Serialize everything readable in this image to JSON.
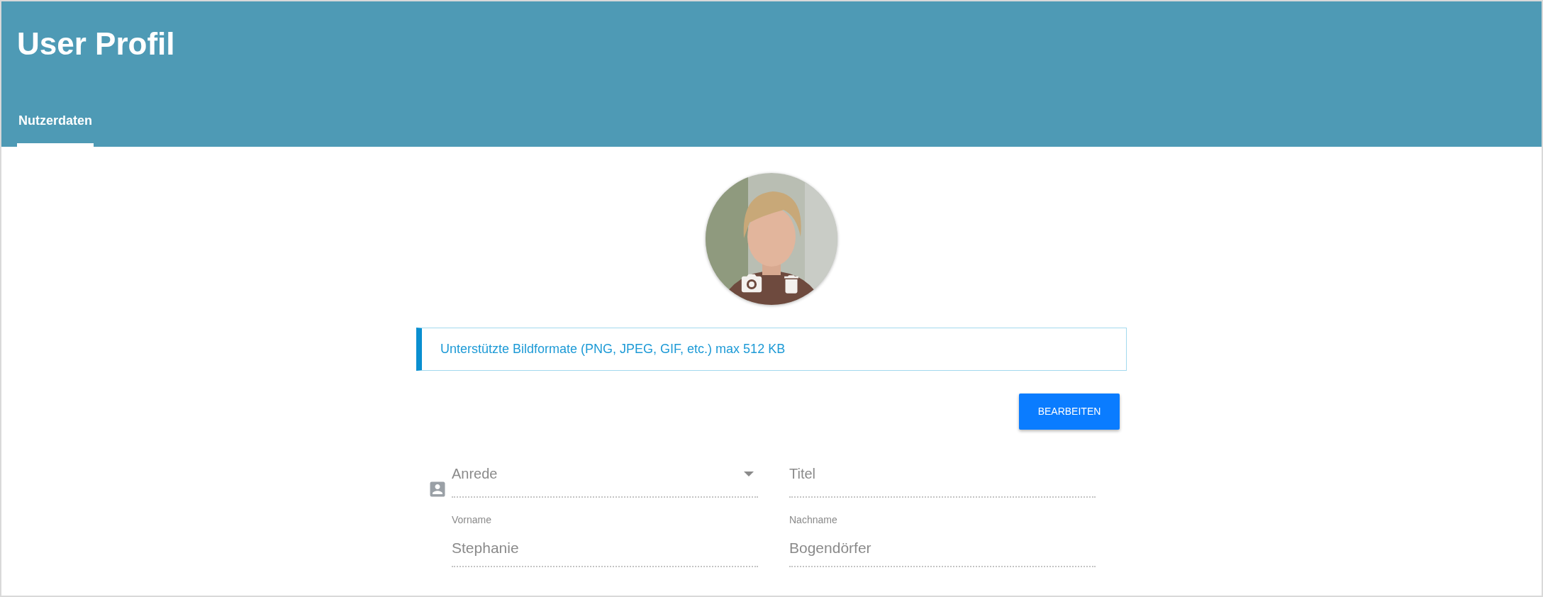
{
  "header": {
    "title": "User Profil"
  },
  "tabs": [
    {
      "label": "Nutzerdaten",
      "selected": true
    }
  ],
  "info": {
    "text": "Unterstützte Bildformate (PNG, JPEG, GIF, etc.) max 512 KB"
  },
  "edit_button": {
    "label": "BEARBEITEN"
  },
  "fields": [
    {
      "kind": "select",
      "placeholder": "Anrede"
    },
    {
      "kind": "text",
      "placeholder": "Titel"
    },
    {
      "kind": "text",
      "label": "Vorname",
      "value": "Stephanie"
    },
    {
      "kind": "text",
      "label": "Nachname",
      "value": "Bogendörfer"
    }
  ]
}
